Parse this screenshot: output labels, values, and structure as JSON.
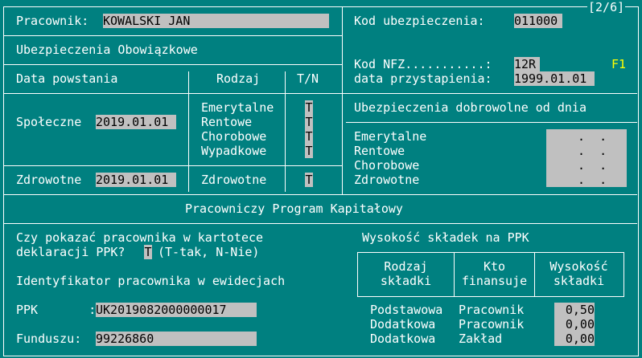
{
  "page_indicator": "[2/6]",
  "employee": {
    "label": "Pracownik:",
    "value": "KOWALSKI JAN"
  },
  "mandatory": {
    "title": "Ubezpieczenia Obowiązkowe",
    "headers": {
      "date": "Data powstania",
      "kind": "Rodzaj",
      "yn": "T/N"
    },
    "social": {
      "label": "Społeczne",
      "date": "2019.01.01",
      "items": [
        {
          "name": "Emerytalne",
          "value": "T"
        },
        {
          "name": "Rentowe",
          "value": "T"
        },
        {
          "name": "Chorobowe",
          "value": "T"
        },
        {
          "name": "Wypadkowe",
          "value": "T"
        }
      ]
    },
    "health": {
      "label": "Zdrowotne",
      "date": "2019.01.01",
      "kind": "Zdrowotne",
      "value": "T"
    }
  },
  "insurance": {
    "code_label": "Kod ubezpieczenia:",
    "code_value": "011000",
    "nfz_label": "Kod NFZ...........:",
    "nfz_value": "12R",
    "nfz_key": "F1",
    "join_label": "data przystapienia:",
    "join_value": "1999.01.01"
  },
  "voluntary": {
    "title": "Ubezpieczenia dobrowolne od dnia",
    "items": [
      {
        "name": "Emerytalne",
        "value": " .  ."
      },
      {
        "name": "Rentowe",
        "value": " .  ."
      },
      {
        "name": "Chorobowe",
        "value": " .  ."
      },
      {
        "name": "Zdrowotne",
        "value": " .  ."
      }
    ]
  },
  "ppk": {
    "title": "Pracowniczy Program Kapitałowy",
    "question_line1": "Czy pokazać pracownika w kartotece",
    "question_line2_prefix": "deklaracji PPK?",
    "question_value": "T",
    "question_hint": "(T-tak, N-Nie)",
    "id_heading": "Identyfikator pracownika w ewidecjach",
    "ppk_label": "PPK       :",
    "ppk_value": "UK2019082000000017",
    "fund_label": "Funduszu:",
    "fund_value": "99226860",
    "contrib_title": "Wysokość składek na PPK",
    "table_headers": [
      {
        "line1": "Rodzaj",
        "line2": "składki"
      },
      {
        "line1": "Kto",
        "line2": "finansuje"
      },
      {
        "line1": "Wysokość",
        "line2": "składki"
      }
    ],
    "rows": [
      {
        "type": "Podstawowa",
        "payer": "Pracownik",
        "amount": "0,50"
      },
      {
        "type": "Dodatkowa",
        "payer": "Pracownik",
        "amount": "0,00"
      },
      {
        "type": "Dodatkowa",
        "payer": "Zakład",
        "amount": "0,00"
      }
    ]
  }
}
